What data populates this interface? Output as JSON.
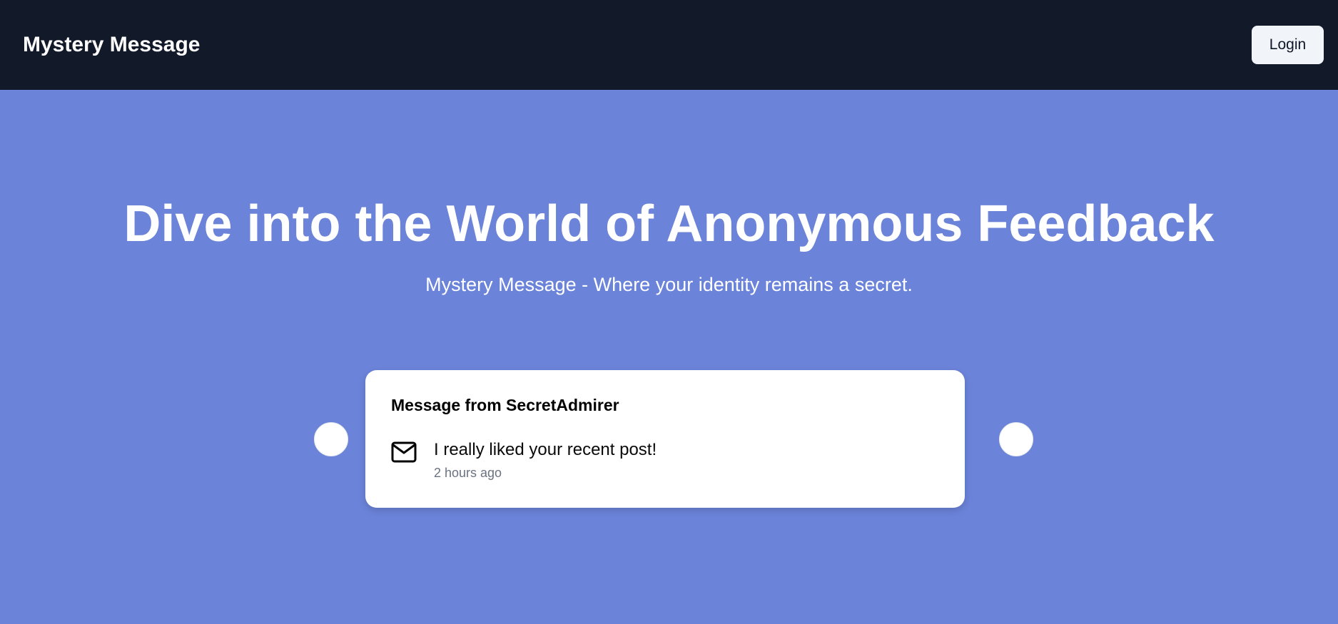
{
  "header": {
    "brand": "Mystery Message",
    "login_label": "Login"
  },
  "hero": {
    "title": "Dive into the World of Anonymous Feedback",
    "subtitle": "Mystery Message - Where your identity remains a secret."
  },
  "carousel": {
    "card": {
      "title": "Message from SecretAdmirer",
      "icon": "mail-icon",
      "content": "I really liked your recent post!",
      "received": "2 hours ago"
    },
    "prev_icon": "carousel-previous",
    "next_icon": "carousel-next"
  },
  "colors": {
    "nav_background": "#121929",
    "hero_background": "#6b83d9",
    "card_background": "#ffffff",
    "muted_text": "#6b7280"
  }
}
